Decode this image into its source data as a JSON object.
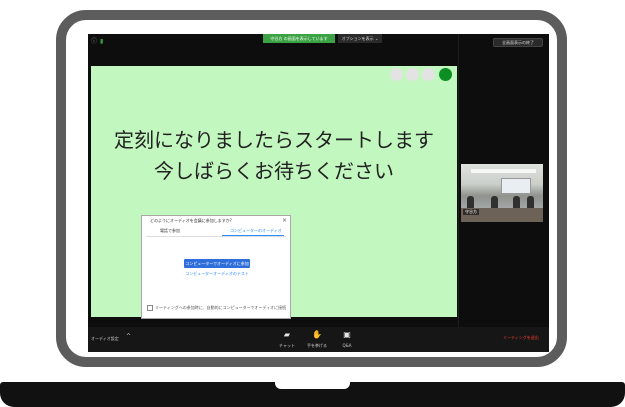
{
  "top_bar": {
    "sharing_status": "守谷方 の画面を表示しています",
    "options_label": "オプションを表示 ⌄",
    "fullscreen_label": "全画面表示の終了"
  },
  "slide": {
    "line1": "定刻になりましたらスタートします",
    "line2": "今しばらくお待ちください"
  },
  "audio_dialog": {
    "title": "どのようにオーディオを会議に参加しますか?",
    "tabs": [
      "電話で参加",
      "コンピューターのオーディオ"
    ],
    "active_tab": 1,
    "join_button": "コンピューターでオーディオに参加",
    "test_link": "コンピューターオーディオのテスト",
    "auto_join_checkbox": "ミーティングへの参加時に、自動的にコンピューターでオーディオに接続",
    "auto_join_checked": false
  },
  "participant": {
    "name": "守谷方"
  },
  "bottom_bar": {
    "audio_settings": "オーディオ設定",
    "tools": [
      {
        "label": "チャット",
        "icon": "chat-icon"
      },
      {
        "label": "手を挙げる",
        "icon": "raise-hand-icon"
      },
      {
        "label": "Q&A",
        "icon": "qa-icon"
      }
    ],
    "leave_label": "ミーティングを退出"
  },
  "colors": {
    "slide_background": "#c3f7c0",
    "sharing_tag": "#3ba343",
    "accent_blue": "#2d8cff",
    "leave_red": "#ff3b30"
  }
}
